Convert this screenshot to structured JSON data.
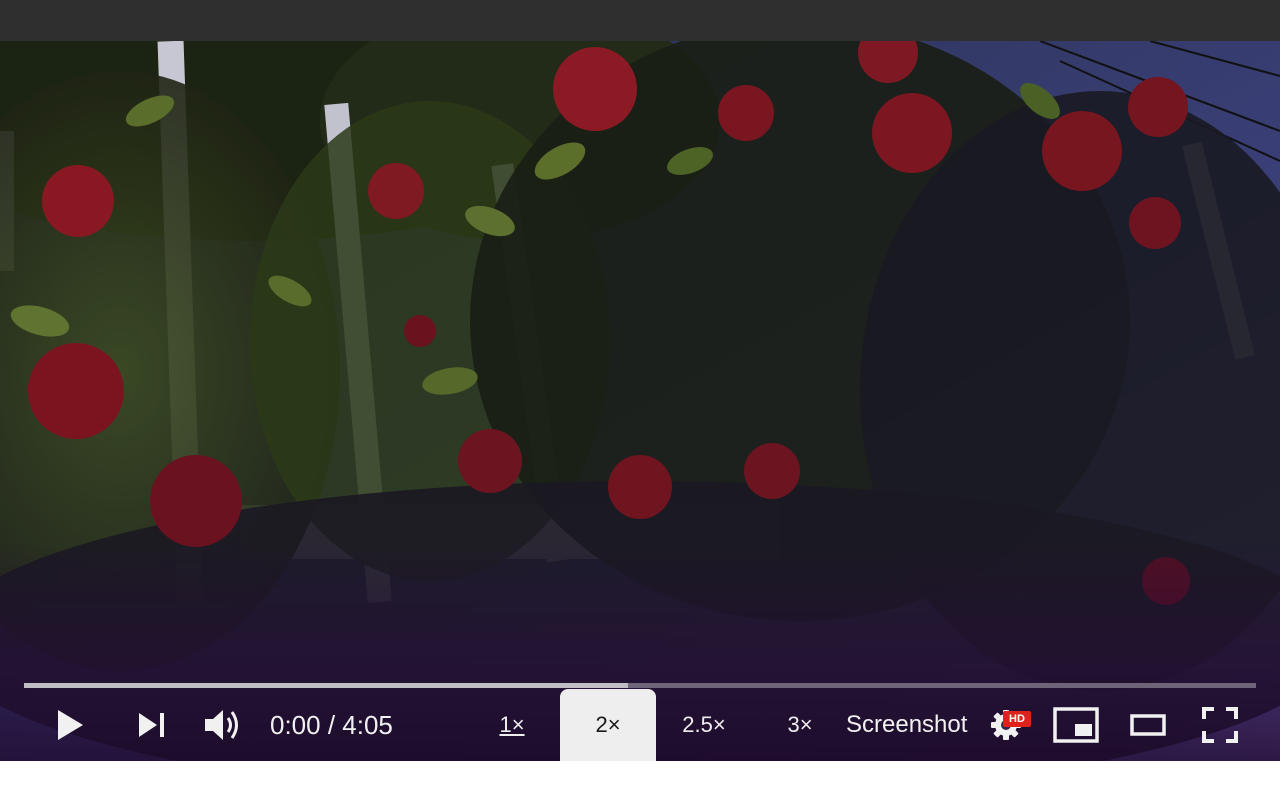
{
  "player": {
    "time_current": "0:00",
    "time_separator": " / ",
    "time_total": "4:05",
    "progress_played_fraction": 0.49,
    "speeds": [
      {
        "label": "1×",
        "state": "underlined"
      },
      {
        "label": "2×",
        "state": "selected"
      },
      {
        "label": "2.5×",
        "state": "normal"
      },
      {
        "label": "3×",
        "state": "normal"
      }
    ],
    "screenshot_label": "Screenshot",
    "hd_badge": "HD",
    "icons": {
      "play": "play-icon",
      "next": "next-icon",
      "volume": "volume-icon",
      "settings": "settings-gear-icon",
      "miniplayer": "miniplayer-icon",
      "theater": "theater-mode-icon",
      "fullscreen": "fullscreen-icon"
    }
  },
  "colors": {
    "topbar": "#2f2f2f",
    "selected_speed_bg": "#eeeeee",
    "hd_badge": "#e0201a"
  }
}
